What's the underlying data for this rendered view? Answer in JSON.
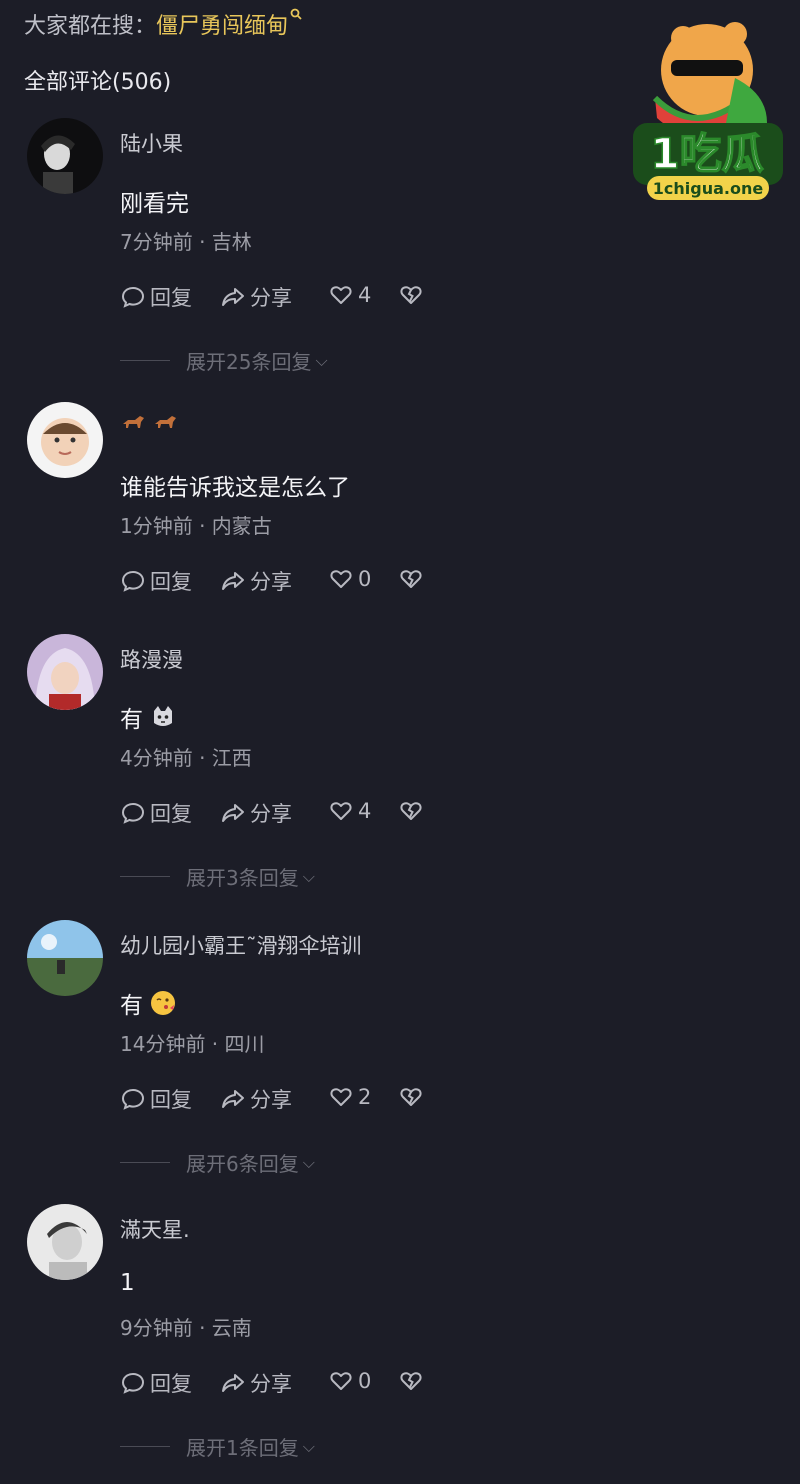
{
  "header": {
    "search_prefix": "大家都在搜：",
    "search_keyword": "僵尸勇闯缅甸",
    "comments_title": "全部评论(506)"
  },
  "logo": {
    "text": "1吃瓜",
    "url_text": "1chigua.one"
  },
  "actions": {
    "reply_label": "回复",
    "share_label": "分享"
  },
  "comments": [
    {
      "username": "陆小果",
      "text": "刚看完",
      "meta": "7分钟前 · 吉林",
      "likes": "4",
      "expand": "展开25条回复"
    },
    {
      "username": "",
      "username_icons": [
        "horse-icon",
        "horse-icon"
      ],
      "text": "谁能告诉我这是怎么了",
      "meta": "1分钟前 · 内蒙古",
      "likes": "0",
      "expand": ""
    },
    {
      "username": "路漫漫",
      "text": "有",
      "text_emoji": "cat-face-icon",
      "meta": "4分钟前 · 江西",
      "likes": "4",
      "expand": "展开3条回复"
    },
    {
      "username": "幼儿园小霸王˜滑翔伞培训",
      "text": "有",
      "text_emoji": "kissing-face-icon",
      "meta": "14分钟前 · 四川",
      "likes": "2",
      "expand": "展开6条回复"
    },
    {
      "username": "滿天星.",
      "text": "1",
      "meta": "9分钟前 · 云南",
      "likes": "0",
      "expand": "展开1条回复"
    }
  ],
  "colors": {
    "background": "#1c1d27",
    "keyword": "#e8c65a",
    "meta": "#9c9da6"
  }
}
